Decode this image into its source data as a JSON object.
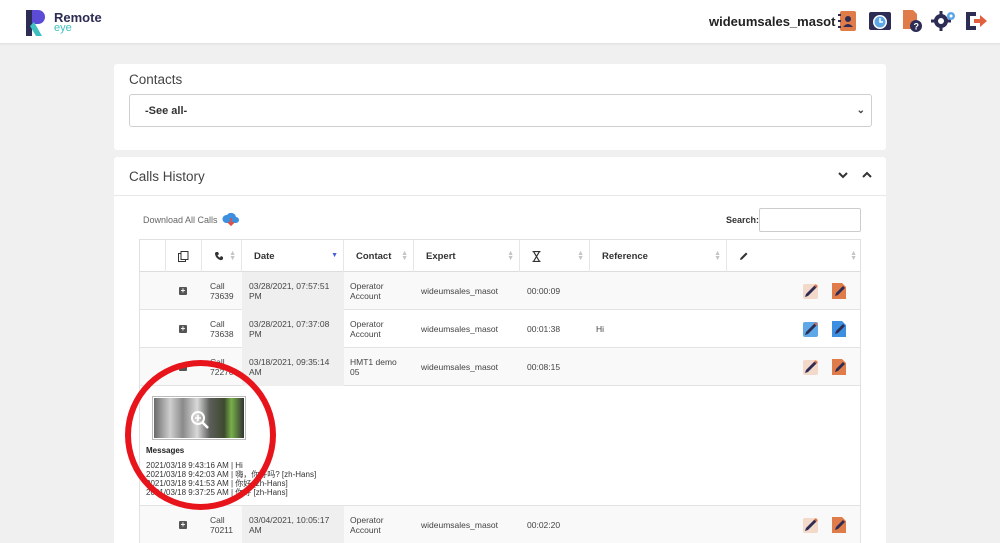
{
  "app": {
    "logo_line1": "Remote",
    "logo_line2": "eye",
    "username": "wideumsales_masot"
  },
  "header_icons": [
    "contacts-book-icon",
    "clock-history-icon",
    "help-file-icon",
    "settings-gears-icon",
    "logout-icon"
  ],
  "contacts": {
    "title": "Contacts",
    "selected": "-See all-"
  },
  "calls": {
    "title": "Calls History",
    "download_label": "Download All Calls",
    "search_label": "Search:",
    "search_value": "",
    "columns": {
      "date": "Date",
      "contact": "Contact",
      "expert": "Expert",
      "reference": "Reference"
    },
    "rows": [
      {
        "call_l1": "Call",
        "call_l2": "73639",
        "date_l1": "03/28/2021, 07:57:51",
        "date_l2": "PM",
        "contact_l1": "Operator",
        "contact_l2": "Account",
        "expert": "wideumsales_masot",
        "duration": "00:00:09",
        "reference": ""
      },
      {
        "call_l1": "Call",
        "call_l2": "73638",
        "date_l1": "03/28/2021, 07:37:08",
        "date_l2": "PM",
        "contact_l1": "Operator",
        "contact_l2": "Account",
        "expert": "wideumsales_masot",
        "duration": "00:01:38",
        "reference": "Hi"
      },
      {
        "call_l1": "Call",
        "call_l2": "72270",
        "date_l1": "03/18/2021, 09:35:14",
        "date_l2": "AM",
        "contact_l1": "HMT1 demo",
        "contact_l2": "05",
        "expert": "wideumsales_masot",
        "duration": "00:08:15",
        "reference": ""
      },
      {
        "call_l1": "Call",
        "call_l2": "70211",
        "date_l1": "03/04/2021, 10:05:17",
        "date_l2": "AM",
        "contact_l1": "Operator",
        "contact_l2": "Account",
        "expert": "wideumsales_masot",
        "duration": "00:02:20",
        "reference": ""
      }
    ],
    "details": {
      "messages_title": "Messages",
      "messages": [
        "2021/03/18 9:43:16 AM | Hi",
        "2021/03/18 9:42:03 AM | 嗨，你好吗?  [zh-Hans]",
        "2021/03/18 9:41:53 AM | 你好 [zh-Hans]",
        "2021/03/18 9:37:25 AM | 你好 [zh-Hans]"
      ]
    }
  },
  "colors": {
    "accent": "#4a5fd8",
    "annotation": "#e8141b",
    "brand_teal": "#3fbfbf"
  }
}
